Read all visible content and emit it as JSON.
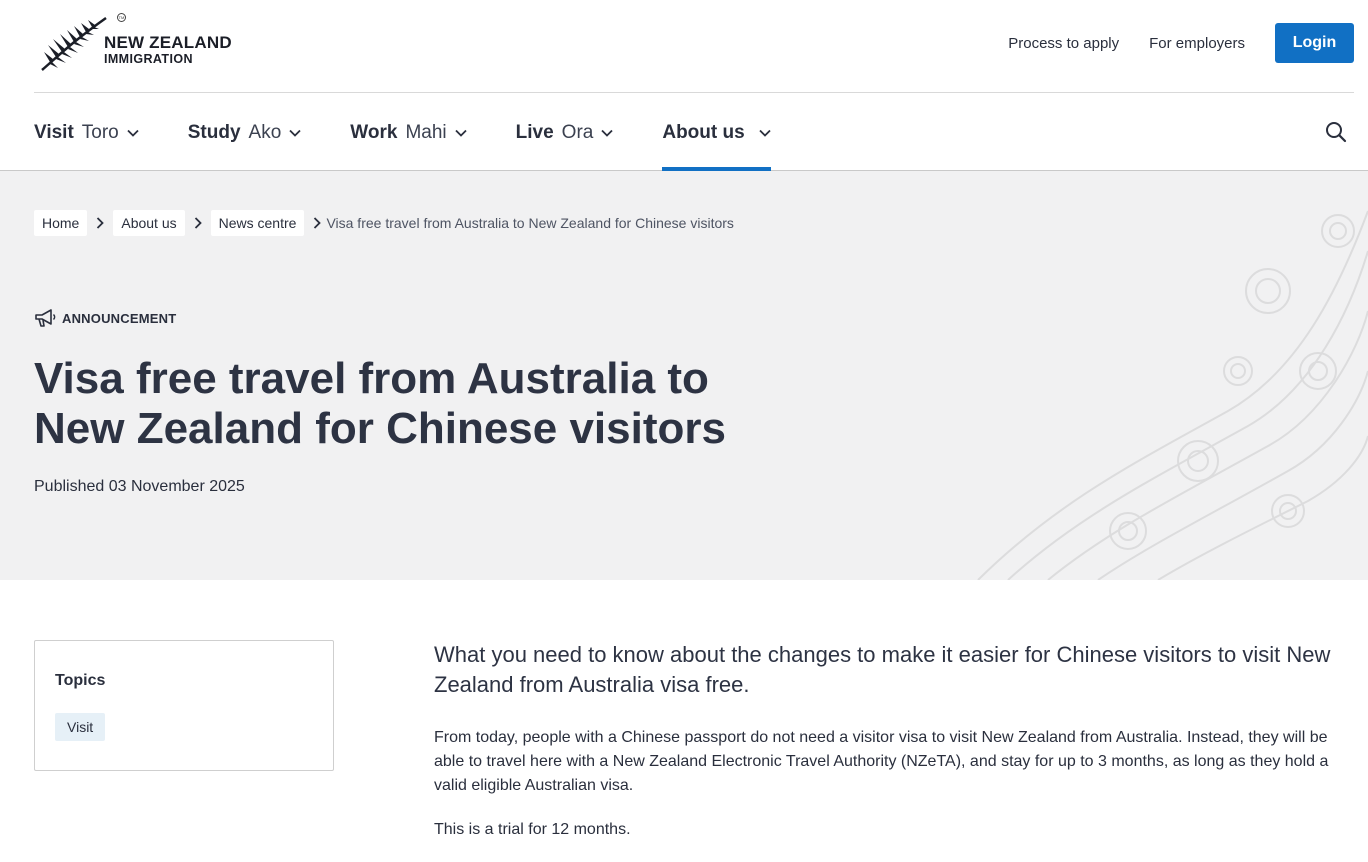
{
  "header": {
    "logo_line1": "NEW ZEALAND",
    "logo_line2": "IMMIGRATION",
    "logo_tm": "TM",
    "links": [
      "Process to apply",
      "For employers"
    ],
    "login_label": "Login"
  },
  "nav": {
    "items": [
      {
        "en": "Visit",
        "mi": "Toro"
      },
      {
        "en": "Study",
        "mi": "Ako"
      },
      {
        "en": "Work",
        "mi": "Mahi"
      },
      {
        "en": "Live",
        "mi": "Ora"
      },
      {
        "en": "About us",
        "mi": ""
      }
    ],
    "active_index": 4,
    "search_icon": "search-icon"
  },
  "breadcrumb": {
    "items": [
      "Home",
      "About us",
      "News centre"
    ],
    "current": "Visa free travel from Australia to New Zealand for Chinese visitors"
  },
  "article": {
    "tag": "ANNOUNCEMENT",
    "tag_icon": "megaphone-icon",
    "title": "Visa free travel from Australia to New Zealand for Chinese visitors",
    "published": "Published 03 November 2025",
    "lead": "What you need to know about the changes to make it easier for Chinese visitors to visit New Zealand from Australia visa free.",
    "paragraphs": [
      "From today, people with a Chinese passport do not need a visitor visa to visit New Zealand from Australia. Instead, they will be able to travel here with a New Zealand Electronic Travel Authority (NZeTA), and stay for up to 3 months, as long as they hold a valid eligible Australian visa.",
      "This is a trial for 12 months."
    ]
  },
  "topics": {
    "title": "Topics",
    "items": [
      "Visit"
    ]
  },
  "colors": {
    "accent": "#1170c4",
    "hero_bg": "#f1f1f2",
    "text": "#2a2f3d"
  }
}
